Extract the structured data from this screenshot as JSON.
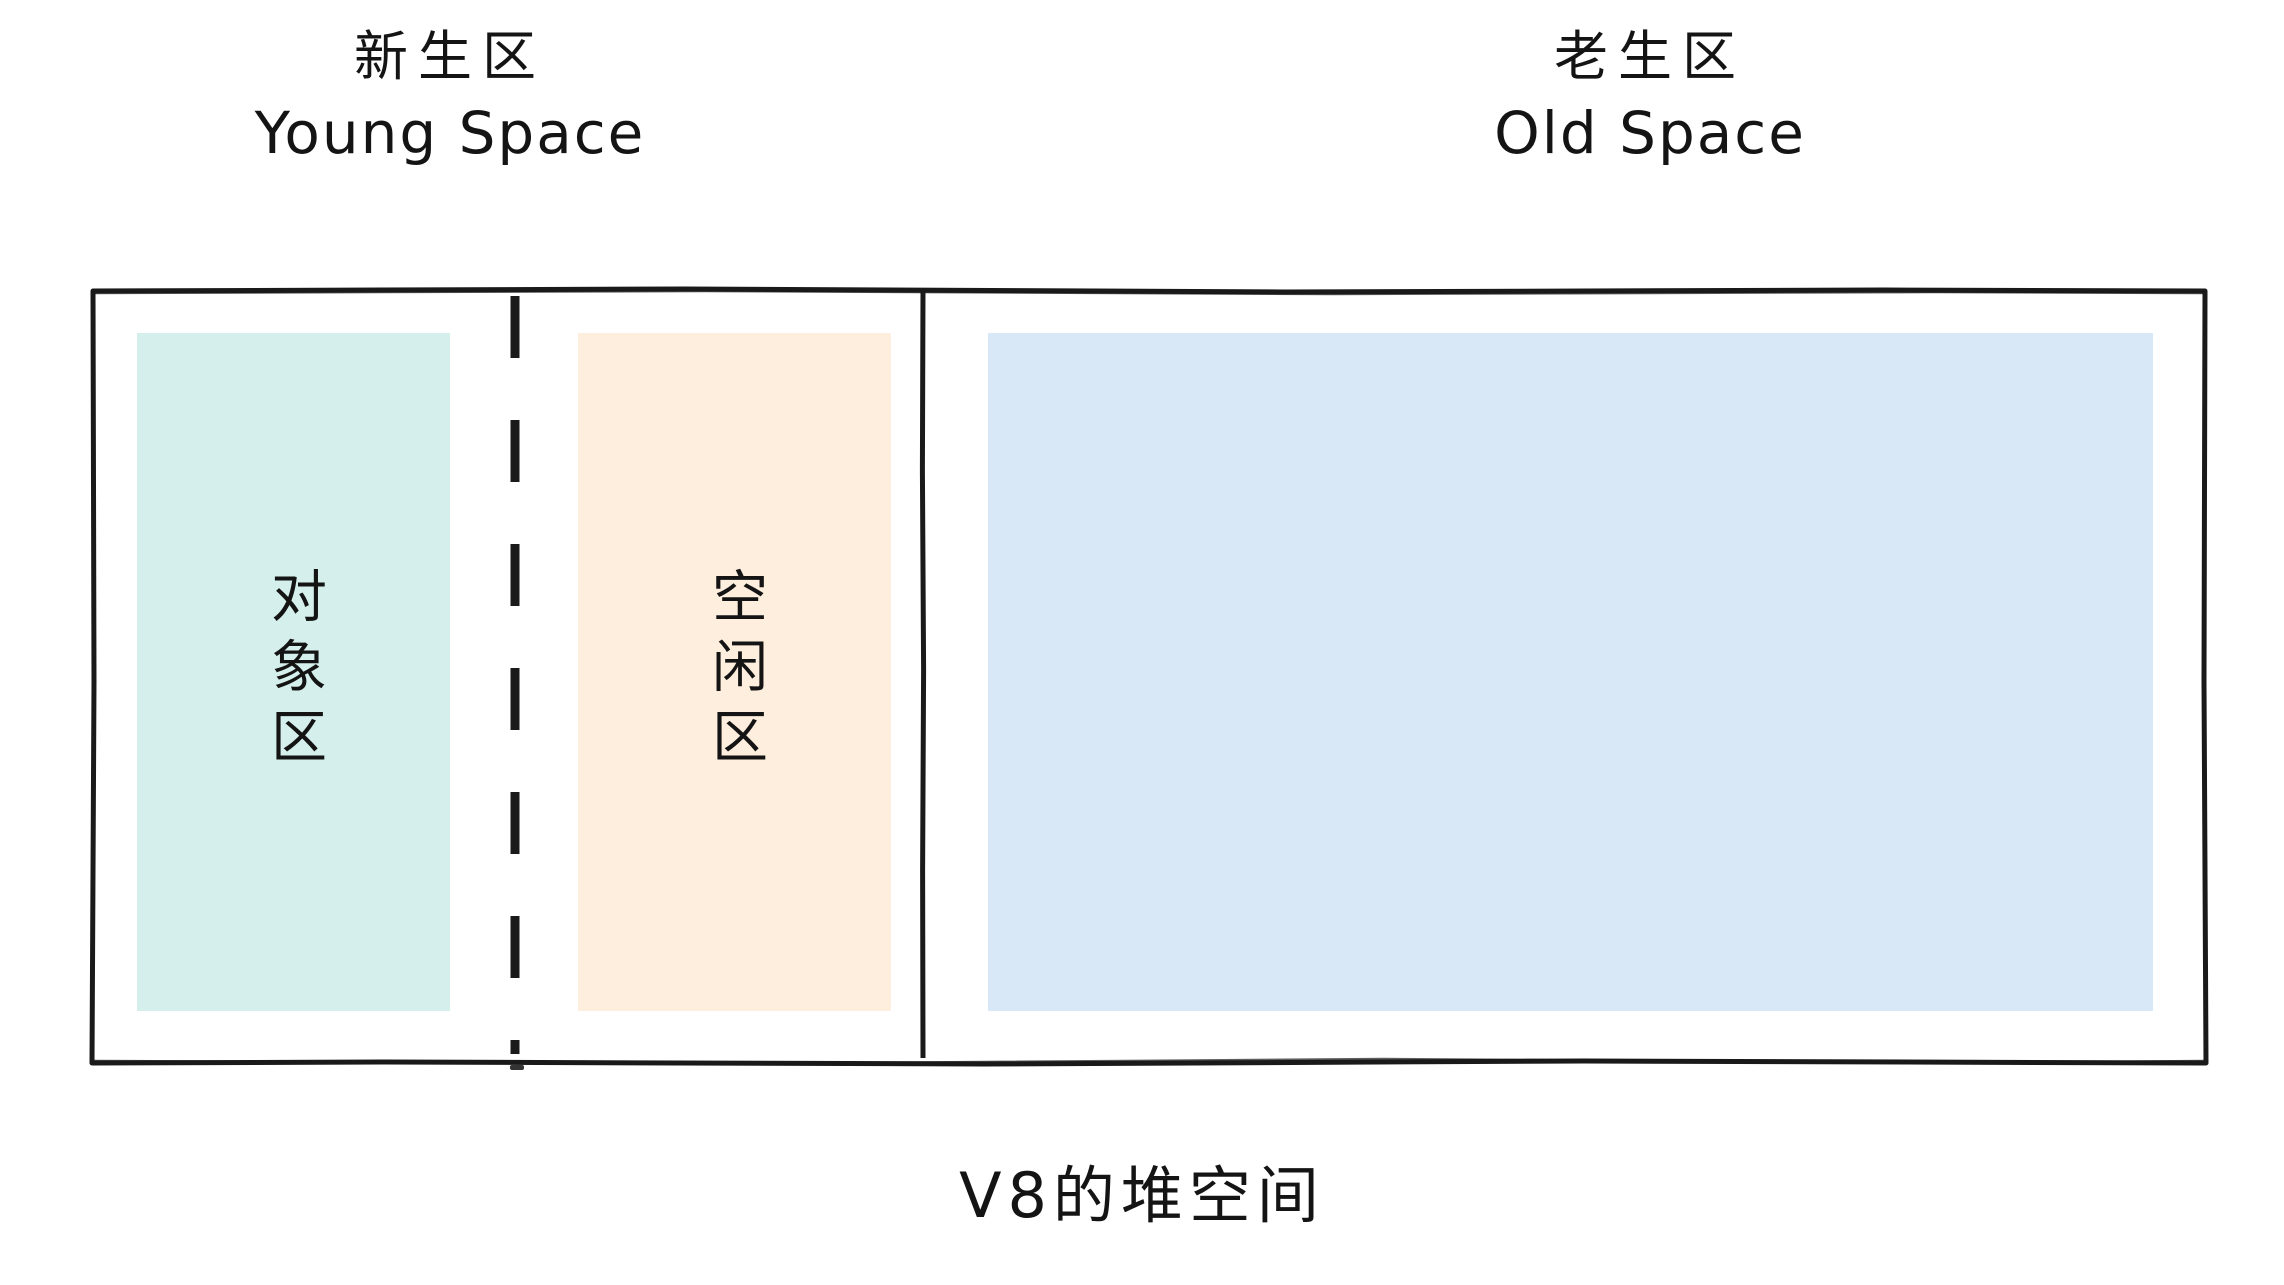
{
  "diagram": {
    "caption": "V8的堆空间",
    "frame": {
      "border_color": "#1a1a1a"
    },
    "spaces": [
      {
        "id": "young",
        "title_cn": "新生区",
        "title_en": "Young Space",
        "divider_style": "dashed",
        "blocks": [
          {
            "id": "object-area",
            "label": "对象区",
            "color": "#d5f0ec"
          },
          {
            "id": "free-area",
            "label": "空闲区",
            "color": "#fdeedd"
          }
        ]
      },
      {
        "id": "old",
        "title_cn": "老生区",
        "title_en": "Old Space",
        "divider_style": "solid",
        "blocks": [
          {
            "id": "old-area",
            "label": "",
            "color": "#d8e8f6"
          }
        ]
      }
    ]
  },
  "chart_data": {
    "type": "diagram",
    "title": "V8的堆空间",
    "regions": [
      {
        "name_cn": "新生区",
        "name_en": "Young Space",
        "width_fraction": 0.393,
        "sub_regions": [
          {
            "name": "对象区",
            "color": "#d5f0ec",
            "width_fraction": 0.5
          },
          {
            "name": "空闲区",
            "color": "#fdeedd",
            "width_fraction": 0.5
          }
        ]
      },
      {
        "name_cn": "老生区",
        "name_en": "Old Space",
        "width_fraction": 0.607,
        "sub_regions": [
          {
            "name": "",
            "color": "#d8e8f6",
            "width_fraction": 1.0
          }
        ]
      }
    ]
  }
}
